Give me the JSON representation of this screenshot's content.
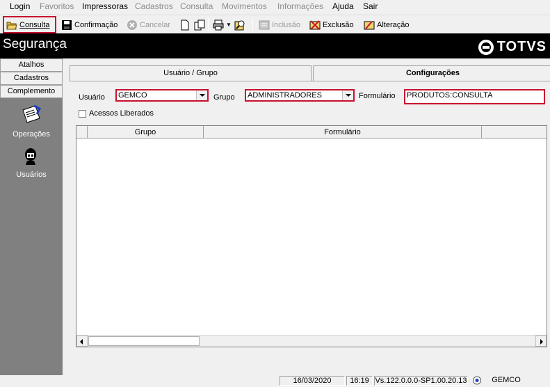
{
  "menubar": {
    "items": [
      {
        "label": "Login",
        "enabled": true
      },
      {
        "label": "Favoritos",
        "enabled": false
      },
      {
        "label": "Impressoras",
        "enabled": true
      },
      {
        "label": "Cadastros",
        "enabled": false
      },
      {
        "label": "Consulta",
        "enabled": false
      },
      {
        "label": "Movimentos",
        "enabled": false
      },
      {
        "label": "Informações",
        "enabled": false
      },
      {
        "label": "Ajuda",
        "enabled": true
      },
      {
        "label": "Sair",
        "enabled": true
      }
    ]
  },
  "toolbar": {
    "consulta": "Consulta",
    "confirmacao": "Confirmação",
    "cancelar": "Cancelar",
    "inclusao": "Inclusão",
    "exclusao": "Exclusão",
    "alteracao": "Alteração"
  },
  "header": {
    "title": "Segurança",
    "logo": "TOTVS"
  },
  "sidebar": {
    "tabs": [
      "Atalhos",
      "Cadastros",
      "Complemento"
    ],
    "ops": [
      "Operações",
      "Usuários"
    ]
  },
  "tabs": {
    "usuario_grupo": "Usuário  / Grupo",
    "configuracoes": "Configurações"
  },
  "form": {
    "usuario_label": "Usuário",
    "usuario_value": "GEMCO",
    "grupo_label": "Grupo",
    "grupo_value": "ADMINISTRADORES",
    "formulario_label": "Formulário",
    "formulario_value": "PRODUTOS:CONSULTA",
    "acessos_label": "Acessos Liberados",
    "acessos_checked": false
  },
  "grid": {
    "columns": [
      "Grupo",
      "Formulário"
    ]
  },
  "status": {
    "date": "16/03/2020",
    "time": "16:19",
    "version": "Vs.122.0.0.0-SP1.00.20.13",
    "user": "GEMCO"
  },
  "colors": {
    "highlight": "#c8102e",
    "header_bg": "#000000",
    "sidebar_bg": "#808080"
  }
}
